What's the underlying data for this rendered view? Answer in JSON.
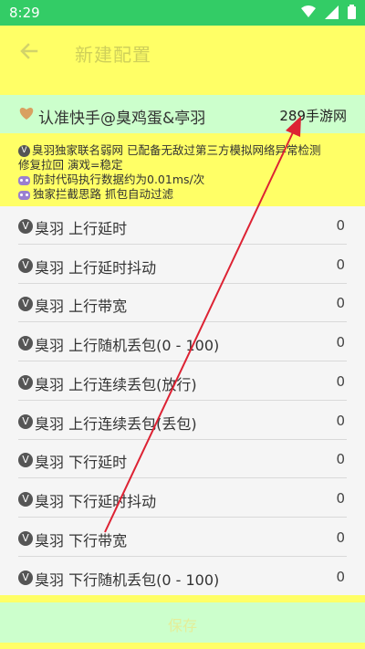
{
  "status_bar": {
    "time": "8:29",
    "icons": [
      "wifi-icon",
      "signal-icon",
      "battery-icon"
    ]
  },
  "app_bar": {
    "title": "新建配置",
    "back_icon": "back-arrow-icon"
  },
  "banner": {
    "text": "认准快手@臭鸡蛋&亭羽",
    "brand": "289手游网",
    "icon": "heart-icon"
  },
  "info": {
    "line1": "臭羽独家联名弱网 已配备无敌过第三方模拟网络异常检测",
    "line2": "修复拉回 演戏=稳定",
    "line3": "防封代码执行数据约为0.01ms/次",
    "line4": "独家拦截思路 抓包自动过滤"
  },
  "settings": [
    {
      "label": "臭羽 上行延时",
      "value": "0"
    },
    {
      "label": "臭羽 上行延时抖动",
      "value": "0"
    },
    {
      "label": "臭羽 上行带宽",
      "value": "0"
    },
    {
      "label": "臭羽 上行随机丢包(0 - 100)",
      "value": "0"
    },
    {
      "label": "臭羽 上行连续丢包(放行)",
      "value": "0"
    },
    {
      "label": "臭羽 上行连续丢包(丢包)",
      "value": "0"
    },
    {
      "label": "臭羽 下行延时",
      "value": "0"
    },
    {
      "label": "臭羽 下行延时抖动",
      "value": "0"
    },
    {
      "label": "臭羽 下行带宽",
      "value": "0"
    },
    {
      "label": "臭羽 下行随机丢包(0 - 100)",
      "value": "0"
    }
  ],
  "save": {
    "label": "保存"
  },
  "colors": {
    "status_bar": "#33cc66",
    "app_bar": "#ffff66",
    "banner": "#ccffcc",
    "annotation_arrow": "#dd2233"
  }
}
